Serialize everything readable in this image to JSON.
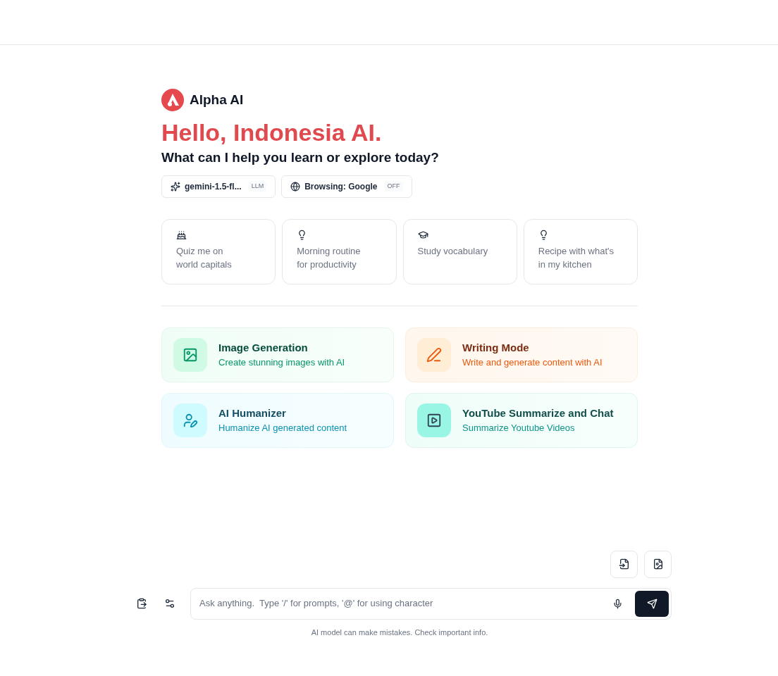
{
  "brand": {
    "name": "Alpha AI"
  },
  "greeting": "Hello, Indonesia AI.",
  "subtitle": "What can I help you learn or explore today?",
  "chips": [
    {
      "kind": "model",
      "label": "gemini-1.5-fl...",
      "badge": "LLM"
    },
    {
      "kind": "browsing",
      "label": "Browsing: Google",
      "badge": "OFF"
    }
  ],
  "suggestions": [
    {
      "kind": "quiz",
      "text": "Quiz me on\nworld capitals"
    },
    {
      "kind": "idea",
      "text": "Morning routine\nfor productivity"
    },
    {
      "kind": "study",
      "text": "Study vocabulary"
    },
    {
      "kind": "idea",
      "text": "Recipe with what's\nin my kitchen"
    }
  ],
  "features": [
    {
      "kind": "image",
      "title": "Image Generation",
      "subtitle": "Create stunning images with AI"
    },
    {
      "kind": "writing",
      "title": "Writing Mode",
      "subtitle": "Write and generate content with AI"
    },
    {
      "kind": "humanizer",
      "title": "AI Humanizer",
      "subtitle": "Humanize AI generated content"
    },
    {
      "kind": "video",
      "title": "YouTube Summarize and Chat",
      "subtitle": "Summarize Youtube Videos"
    }
  ],
  "input": {
    "placeholder": "Ask anything.  Type '/' for prompts, '@' for using character"
  },
  "disclaimer": "AI model can make mistakes. Check important info."
}
